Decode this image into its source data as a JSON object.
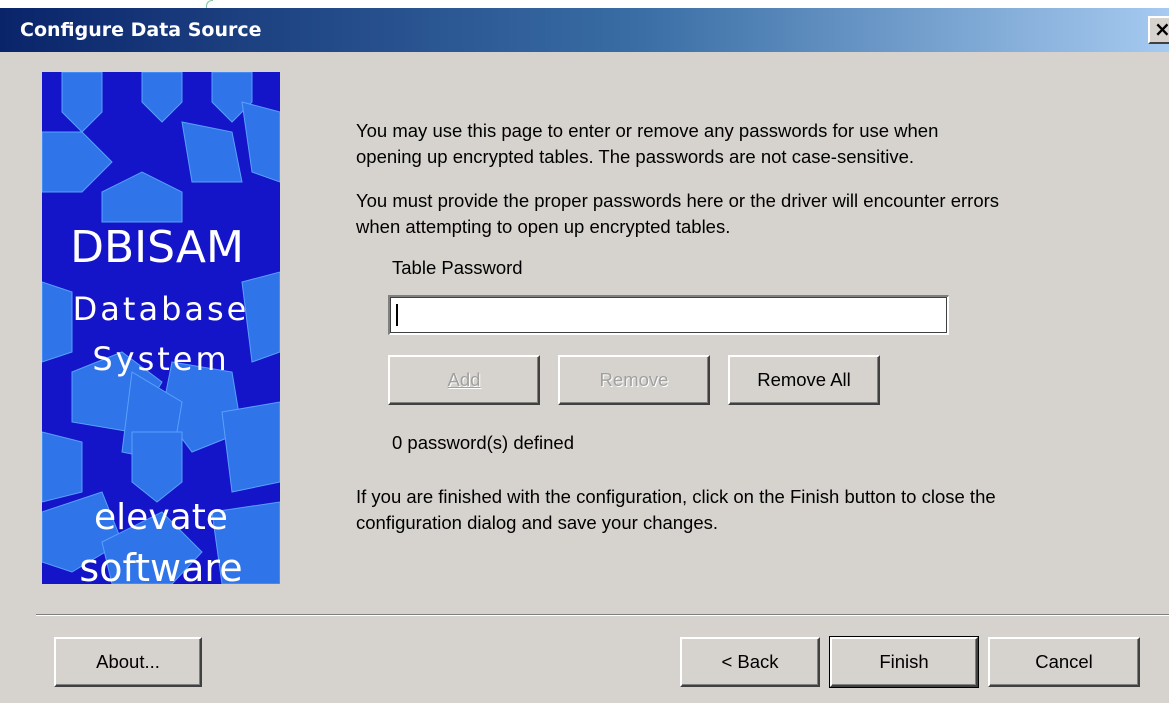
{
  "window": {
    "title": "Configure Data Source",
    "close_label": "×"
  },
  "banner": {
    "line1": "DBISAM",
    "line2": "Database",
    "line3": "System",
    "line4": "elevate",
    "line5": "software"
  },
  "content": {
    "intro": [
      "You may use this page to enter or remove any passwords for use when",
      "opening up encrypted tables.  The passwords are not case-sensitive."
    ],
    "warning": [
      "You must provide the proper passwords here or the driver will encounter errors",
      "when attempting to open up encrypted tables."
    ],
    "password_label": "Table Password",
    "password_value": "",
    "buttons": {
      "add": "Add",
      "remove": "Remove",
      "remove_all": "Remove All"
    },
    "count_text": "0 password(s) defined",
    "finish_note": [
      "If you are finished with the configuration, click on the Finish button to close the",
      "configuration dialog and save your changes."
    ]
  },
  "footer": {
    "about": "About...",
    "back": "< Back",
    "finish": "Finish",
    "cancel": "Cancel"
  },
  "colors": {
    "banner_bg": "#1414c8",
    "banner_shape": "#2f74e8",
    "dialog_bg": "#d6d3ce",
    "title_start": "#0a246a",
    "title_end": "#a6caf0"
  }
}
